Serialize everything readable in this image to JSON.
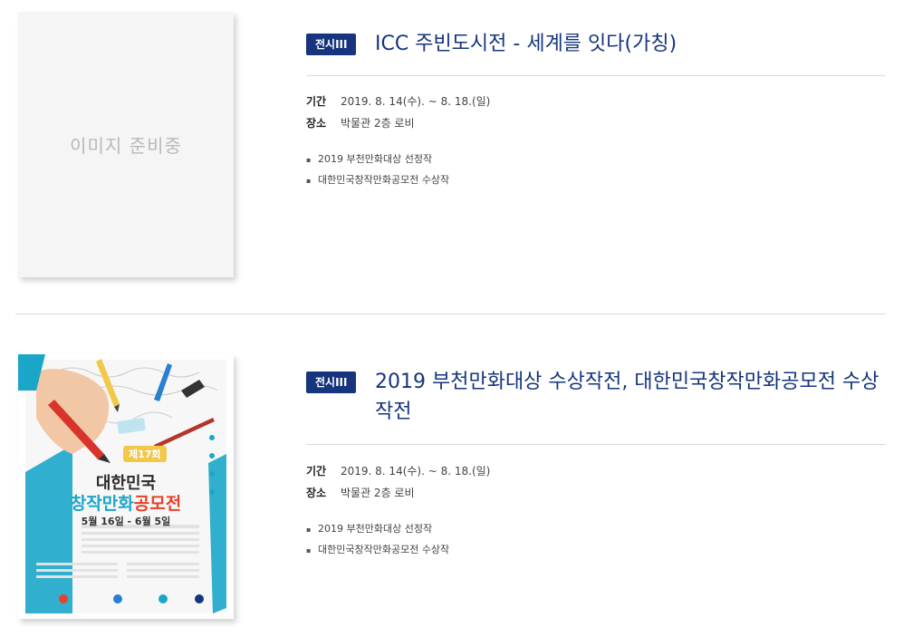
{
  "items": [
    {
      "badge": "전시III",
      "title": "ICC 주빈도시전 - 세계를 잇다(가칭)",
      "image_placeholder": "이미지 준비중",
      "period_label": "기간",
      "period_value": "2019. 8. 14(수). ~ 8. 18.(일)",
      "place_label": "장소",
      "place_value": "박물관 2층 로비",
      "bullets": [
        "2019 부천만화대상 선정작",
        "대한민국창작만화공모전 수상작"
      ]
    },
    {
      "badge": "전시III",
      "title": "2019 부천만화대상 수상작전, 대한민국창작만화공모전 수상작전",
      "poster": {
        "edition": "제17회",
        "line1": "대한민국",
        "line2a": "창작만화",
        "line2b": "공모전",
        "dates": "5월 16일 - 6월 5일"
      },
      "period_label": "기간",
      "period_value": "2019. 8. 14(수). ~ 8. 18.(일)",
      "place_label": "장소",
      "place_value": "박물관 2층 로비",
      "bullets": [
        "2019 부천만화대상 선정작",
        "대한민국창작만화공모전 수상작"
      ]
    }
  ],
  "colors": {
    "accent": "#16357e",
    "rule": "#dcdcdc",
    "poster_blue": "#1aa6c9",
    "poster_red": "#e8412b"
  }
}
